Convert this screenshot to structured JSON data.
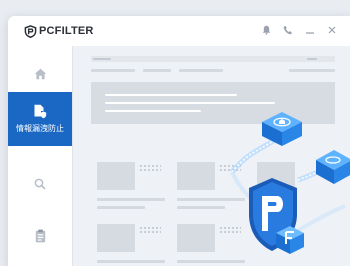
{
  "app": {
    "brand": "PCFILTER"
  },
  "sidebar": {
    "items": [
      {
        "icon": "home-icon"
      },
      {
        "icon": "shield-document-icon",
        "label": "情報漏洩防止",
        "active": true
      },
      {
        "icon": "search-icon"
      },
      {
        "icon": "clipboard-icon"
      }
    ]
  },
  "colors": {
    "accent": "#1a68c4",
    "background": "#eef1f5",
    "cube_blue": "#2a86e6"
  }
}
